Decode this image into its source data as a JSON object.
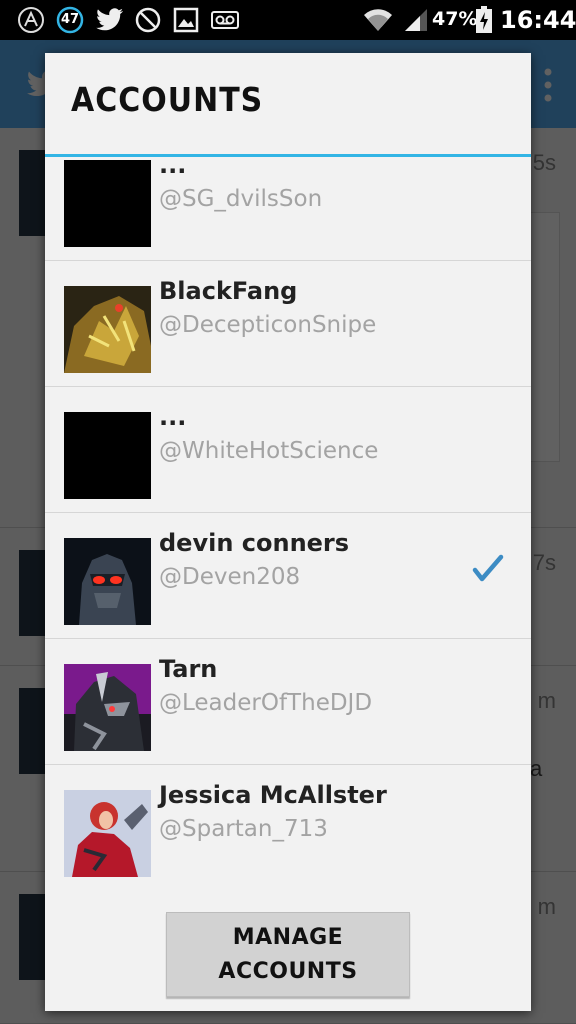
{
  "status_bar": {
    "notification_count": "47",
    "battery": "47%",
    "time": "16:44",
    "icons": [
      "android-icon",
      "notification-count-icon",
      "twitter-bird-icon",
      "do-not-disturb-icon",
      "image-icon",
      "voicemail-icon",
      "wifi-icon",
      "signal-icon",
      "battery-charging-icon"
    ]
  },
  "dialog": {
    "title": "ACCOUNTS",
    "accent_color": "#33b5e5",
    "accounts": [
      {
        "name": "...",
        "handle": "@SG_dvilsSon",
        "avatar": "black-avatar",
        "selected": false
      },
      {
        "name": "BlackFang",
        "handle": "@DecepticonSnipe",
        "avatar": "robot-gold-avatar",
        "selected": false
      },
      {
        "name": "...",
        "handle": "@WhiteHotScience",
        "avatar": "black-avatar",
        "selected": false
      },
      {
        "name": "devin conners",
        "handle": "@Deven208",
        "avatar": "robot-red-visor-avatar",
        "selected": true
      },
      {
        "name": "Tarn",
        "handle": "@LeaderOfTheDJD",
        "avatar": "robot-purple-avatar",
        "selected": false
      },
      {
        "name": "Jessica McAllster",
        "handle": "@Spartan_713",
        "avatar": "red-armor-avatar",
        "selected": false
      }
    ],
    "check_color": "#3d8cc4",
    "manage_button": "MANAGE\nACCOUNTS"
  },
  "background": {
    "times": [
      "5s",
      "7s",
      "m",
      "m"
    ],
    "partial_text": "a",
    "action_bar_color": "#55acee"
  }
}
